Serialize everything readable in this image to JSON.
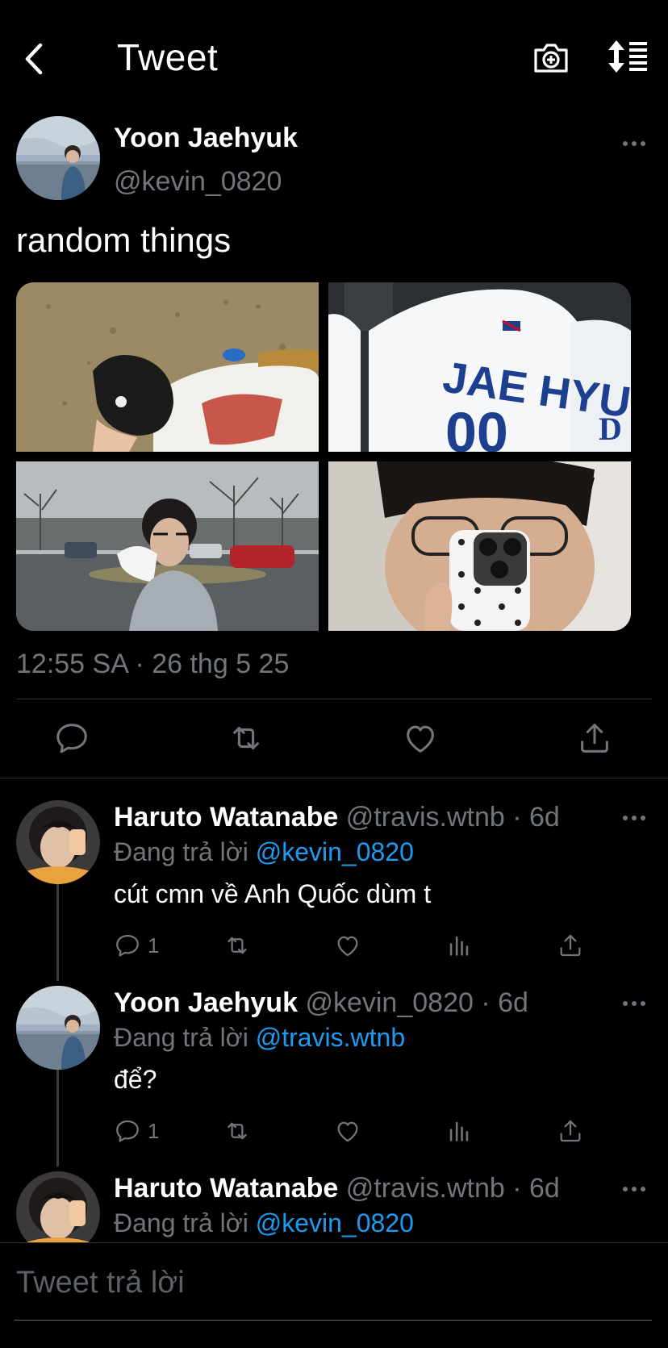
{
  "header": {
    "title": "Tweet",
    "back_icon": "chevron-left-icon",
    "camera_icon": "camera-plus-icon",
    "sort_icon": "sort-list-icon"
  },
  "tweet": {
    "name": "Yoon Jaehyuk",
    "handle": "@kevin_0820",
    "text": "random things",
    "timestamp": "12:55 SA · 26 thg 5 25",
    "photos": [
      "glove-on-grass",
      "jae-hyuk-jersey",
      "parking-lot-portrait",
      "mirror-selfie"
    ],
    "actions": [
      "reply",
      "retweet",
      "like",
      "share"
    ]
  },
  "replies": [
    {
      "name": "Haruto Watanabe",
      "handle": "@travis.wtnb · 6d",
      "replying_prefix": "Đang trả lời",
      "replying_to": "@kevin_0820",
      "text": "cút cmn về Anh Quốc dùm t",
      "reply_count": "1"
    },
    {
      "name": "Yoon Jaehyuk",
      "handle": "@kevin_0820 · 6d",
      "replying_prefix": "Đang trả lời",
      "replying_to": "@travis.wtnb",
      "text": "để?",
      "reply_count": "1"
    },
    {
      "name": "Haruto Watanabe",
      "handle": "@travis.wtnb · 6d",
      "replying_prefix": "Đang trả lời",
      "replying_to": "@kevin_0820"
    }
  ],
  "composer": {
    "placeholder": "Tweet trả lời"
  },
  "colors": {
    "background": "#000000",
    "text": "#ffffff",
    "muted": "#71767b",
    "link": "#1d9bf0",
    "divider": "#2f3336"
  }
}
